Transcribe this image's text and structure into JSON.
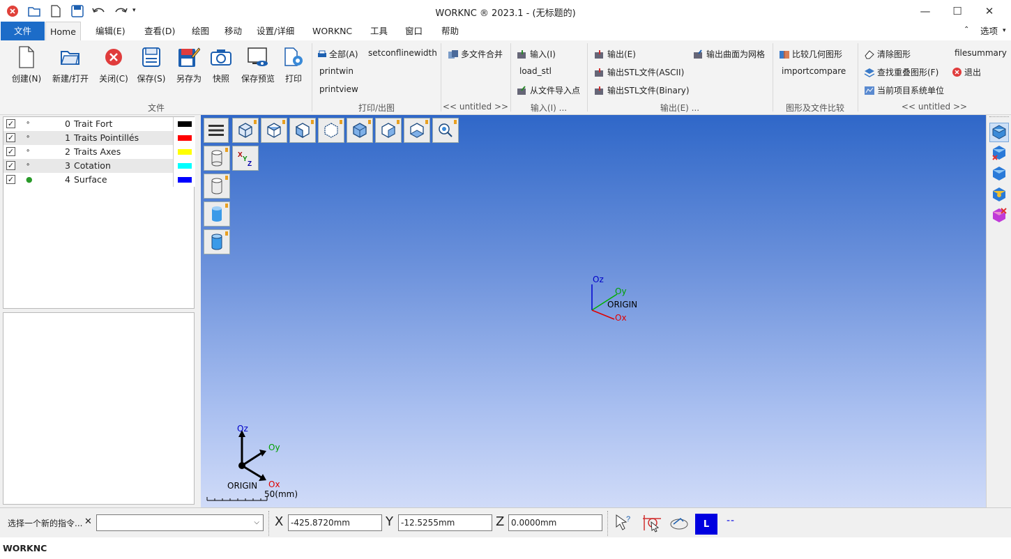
{
  "window": {
    "title": "WORKNC ® 2023.1 - (无标题的)"
  },
  "menu": {
    "file": "文件",
    "home": "Home",
    "edit": "编辑(E)",
    "view": "查看(D)",
    "draw": "绘图",
    "move": "移动",
    "settings": "设置/详细",
    "worknc": "WORKNC",
    "tools": "工具",
    "window": "窗口",
    "help": "帮助",
    "options": "选项"
  },
  "ribbon": {
    "create": "创建(N)",
    "new_open": "新建/打开",
    "close": "关闭(C)",
    "save": "保存(S)",
    "save_as": "另存为",
    "snapshot": "快照",
    "save_preview": "保存预览",
    "print": "打印",
    "group_file": "文件",
    "all": "全部(A)",
    "setconflinewidth": "setconflinewidth",
    "printwin": "printwin",
    "printview": "printview",
    "group_print": "打印/出图",
    "multi_merge": "多文件合并",
    "group_untitled1": "<< untitled >>",
    "input": "输入(I)",
    "load_stl": "load_stl",
    "import_points": "从文件导入点",
    "group_input": "输入(I) ...",
    "output": "输出(E)",
    "output_mesh": "输出曲面为网格",
    "output_stl_ascii": "输出STL文件(ASCII)",
    "output_stl_binary": "输出STL文件(Binary)",
    "group_output": "输出(E) ...",
    "compare_geom": "比较几何图形",
    "importcompare": "importcompare",
    "group_compare": "图形及文件比较",
    "clear_graphics": "清除图形",
    "filesummary": "filesummary",
    "find_overlap": "查找重叠图形(F)",
    "exit": "退出",
    "units": "当前项目系统单位",
    "group_untitled2": "<< untitled >>"
  },
  "layers": [
    {
      "num": "0",
      "name": "Trait Fort",
      "color": "#000000",
      "dot": "∘"
    },
    {
      "num": "1",
      "name": "Traits Pointillés",
      "color": "#ff0000",
      "dot": "∘"
    },
    {
      "num": "2",
      "name": "Traits Axes",
      "color": "#ffff00",
      "dot": "∘"
    },
    {
      "num": "3",
      "name": "Cotation",
      "color": "#00ffff",
      "dot": "∘"
    },
    {
      "num": "4",
      "name": "Surface",
      "color": "#0000ff",
      "dot": "●"
    }
  ],
  "viewport": {
    "oz": "Oz",
    "oy": "Oy",
    "ox": "Ox",
    "origin_label": "ORIGIN",
    "origin_center": "ORIGIN",
    "scale": "50(mm)"
  },
  "command": {
    "prompt": "选择一个新的指令...",
    "x_label": "X",
    "x_value": "-425.8720mm",
    "y_label": "Y",
    "y_value": "-12.5255mm",
    "z_label": "Z",
    "z_value": "0.0000mm",
    "layer_badge": "L",
    "line_style": "--"
  },
  "status": {
    "text": "WORKNC"
  }
}
